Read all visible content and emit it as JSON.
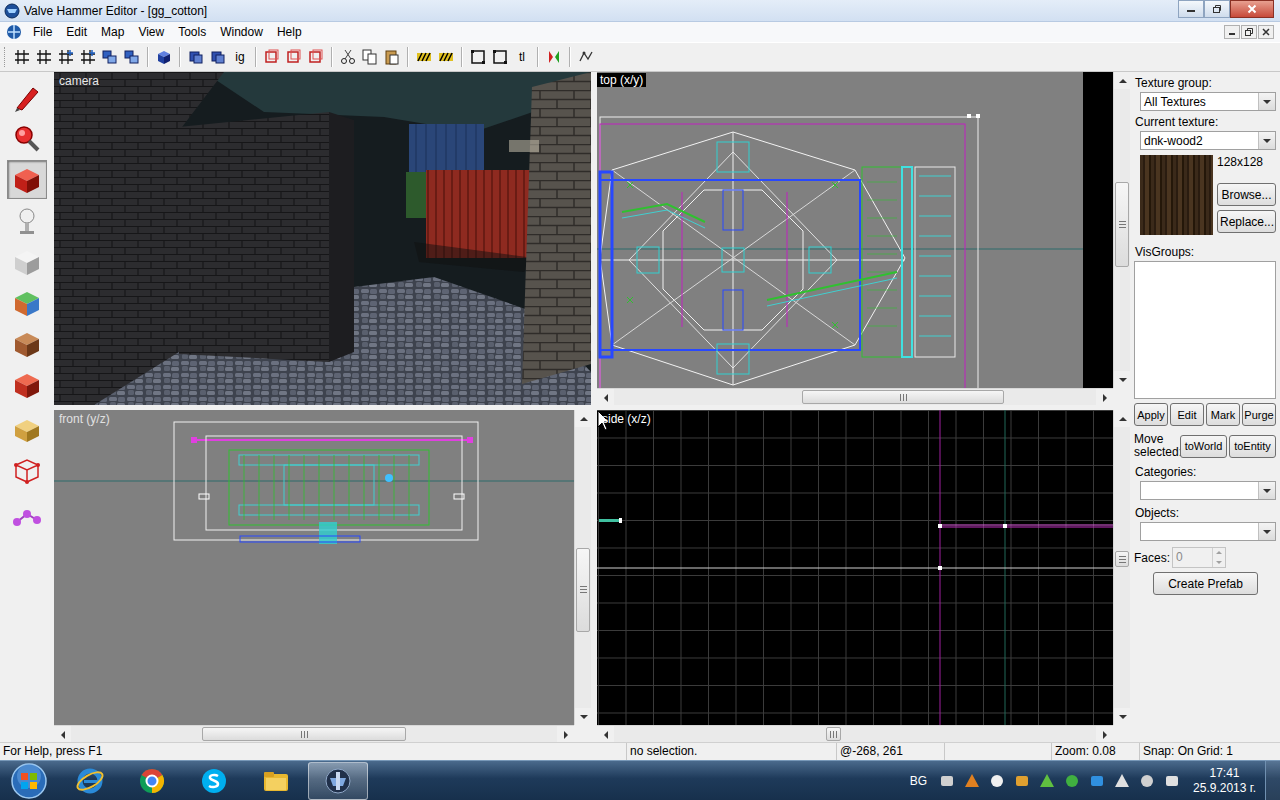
{
  "window": {
    "title": "Valve Hammer Editor - [gg_cotton]"
  },
  "menu": [
    "File",
    "Edit",
    "Map",
    "View",
    "Tools",
    "Window",
    "Help"
  ],
  "toolbar": {
    "texts": [
      "ig",
      "tl"
    ]
  },
  "toolbox": [
    {
      "selected": false
    },
    {
      "selected": false
    },
    {
      "selected": true
    },
    {
      "selected": false
    },
    {
      "selected": false
    },
    {
      "selected": false
    },
    {
      "selected": false
    },
    {
      "selected": false
    },
    {
      "selected": false
    },
    {
      "selected": false
    },
    {
      "selected": false
    }
  ],
  "viewports": {
    "camera": {
      "label": "camera"
    },
    "top": {
      "label": "top (x/y)",
      "h_scroll": {
        "start": 0.39,
        "size": 0.42
      },
      "v_scroll": {
        "start": 0.33,
        "size": 0.3
      }
    },
    "front": {
      "label": "front (y/z)",
      "h_scroll": {
        "start": 0.27,
        "size": 0.42
      },
      "v_scroll": {
        "start": 0.43,
        "size": 0.3
      }
    },
    "side": {
      "label": "side (x/z)",
      "h_scroll": {
        "start": 0.44,
        "size": 0.03
      },
      "v_scroll": {
        "start": 0.44,
        "size": 0.06
      }
    }
  },
  "texture_panel": {
    "texture_group_label": "Texture group:",
    "texture_group": "All Textures",
    "current_texture_label": "Current texture:",
    "current_texture": "dnk-wood2",
    "texture_size": "128x128",
    "browse": "Browse...",
    "replace": "Replace...",
    "visgroups_label": "VisGroups:",
    "visgroup_buttons": [
      "Apply",
      "Edit",
      "Mark",
      "Purge"
    ],
    "move_selected_label": "Move selected:",
    "move_buttons": [
      "toWorld",
      "toEntity"
    ],
    "categories_label": "Categories:",
    "objects_label": "Objects:",
    "faces_label": "Faces:",
    "faces": {
      "value": "0",
      "disabled": true
    },
    "create_prefab": "Create Prefab"
  },
  "status_bar": [
    "For Help, press F1",
    "no selection.",
    "@-268, 261",
    "",
    "Zoom: 0.08",
    "Snap: On Grid: 1"
  ],
  "taskbar": {
    "apps": [
      {
        "selected": false
      },
      {
        "selected": false
      },
      {
        "selected": false
      },
      {
        "selected": false
      },
      {
        "selected": true
      }
    ],
    "language": "BG",
    "time": "17:41",
    "date": "25.9.2013 г."
  }
}
